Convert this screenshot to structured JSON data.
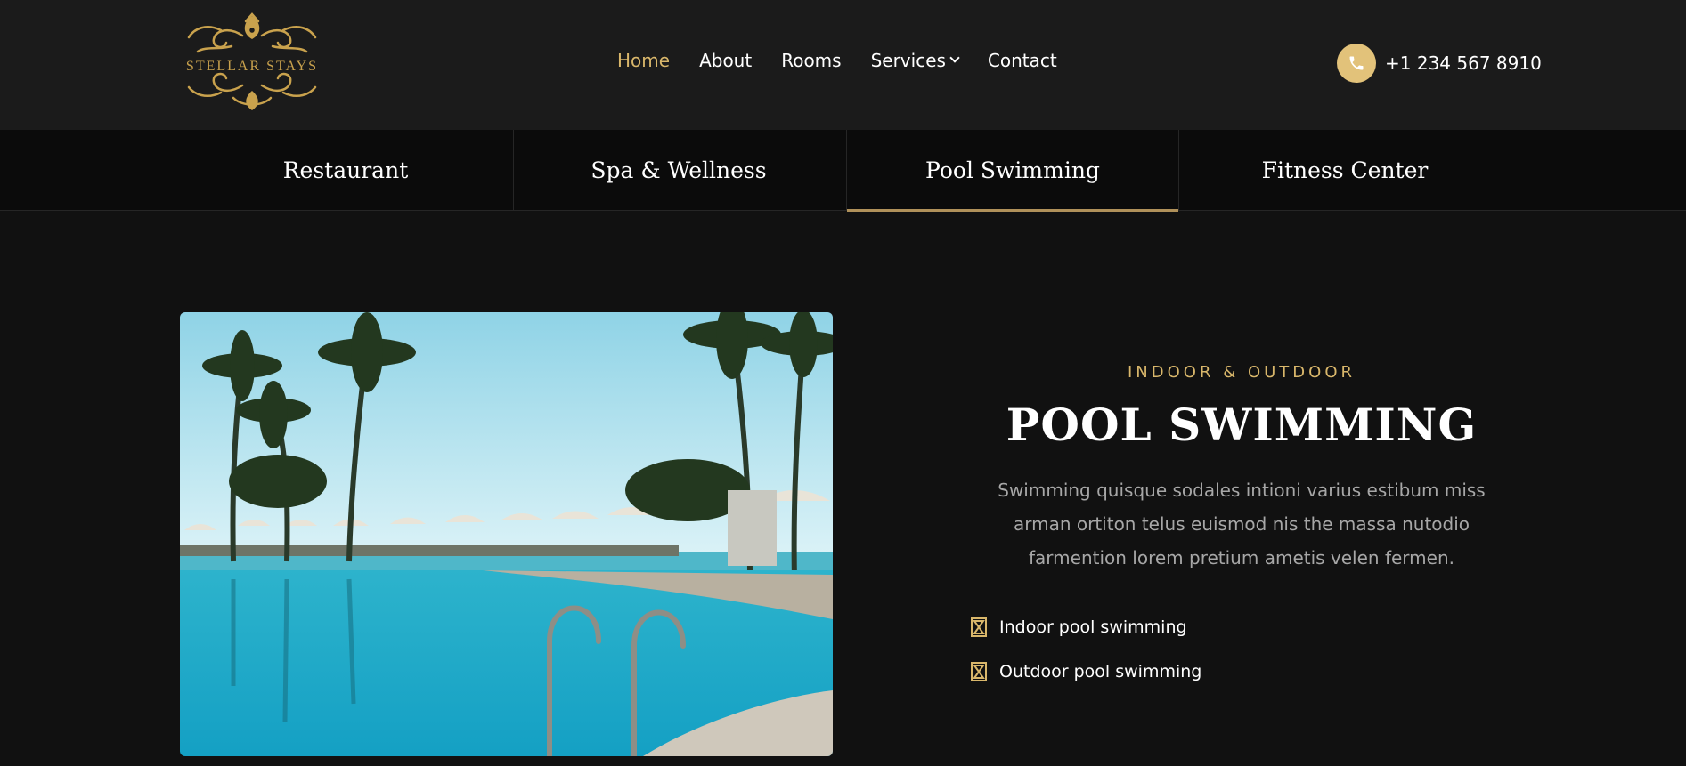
{
  "brand": {
    "name": "STELLAR STAYS",
    "accent": "#d9b76b",
    "gold": "#c9a24d"
  },
  "nav": {
    "items": [
      {
        "label": "Home",
        "active": true
      },
      {
        "label": "About"
      },
      {
        "label": "Rooms"
      },
      {
        "label": "Services",
        "dropdown": true
      },
      {
        "label": "Contact"
      }
    ]
  },
  "phone": {
    "icon": "phone-icon",
    "number": "+1 234 567 8910"
  },
  "tabs": [
    {
      "label": "Restaurant"
    },
    {
      "label": "Spa & Wellness"
    },
    {
      "label": "Pool Swimming",
      "active": true
    },
    {
      "label": "Fitness Center"
    }
  ],
  "section": {
    "eyebrow": "INDOOR & OUTDOOR",
    "title": "POOL SWIMMING",
    "description": "Swimming quisque sodales intioni varius estibum miss arman ortiton telus euismod nis the massa nutodio farmention lorem pretium ametis velen fermen.",
    "features": [
      {
        "icon": "hourglass-icon",
        "label": "Indoor pool swimming"
      },
      {
        "icon": "hourglass-icon",
        "label": "Outdoor pool swimming"
      }
    ]
  }
}
